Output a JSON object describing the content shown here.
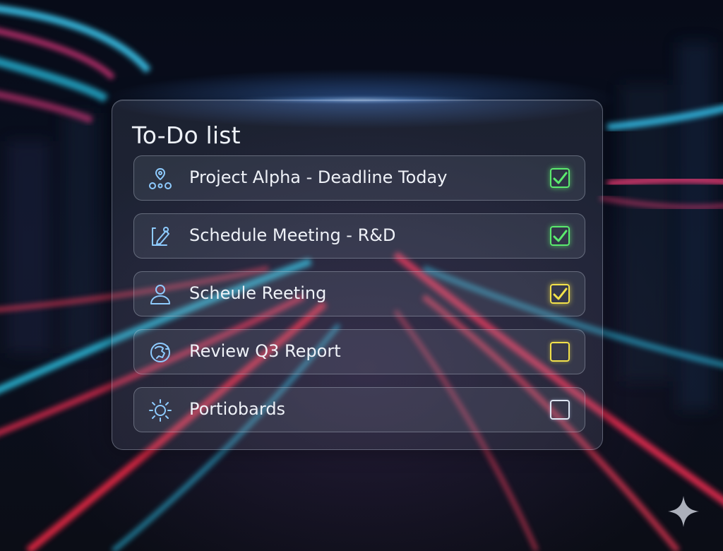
{
  "todo": {
    "title": "To-Do list",
    "tasks": [
      {
        "label": "Project Alpha - Deadline Today",
        "icon": "location-pin-nodes-icon",
        "state": "checked",
        "check_color": "#5bea6e"
      },
      {
        "label": "Schedule Meeting - R&D",
        "icon": "calendar-edit-icon",
        "state": "checked",
        "check_color": "#5bea6e"
      },
      {
        "label": "Scheule Reeting",
        "icon": "user-icon",
        "state": "checked",
        "check_color": "#f2e14a"
      },
      {
        "label": "Review Q3 Report",
        "icon": "refresh-globe-icon",
        "state": "unchecked",
        "check_color": "#f2e14a"
      },
      {
        "label": "Portiobards",
        "icon": "sun-icon",
        "state": "unchecked",
        "check_color": "#dfe6f2"
      }
    ]
  },
  "colors": {
    "accent_blue": "#4aa3ff",
    "icon_stroke": "#8ecbff",
    "check_green": "#5bea6e",
    "check_yellow": "#f2e14a"
  },
  "decor": {
    "corner_mark": "sparkle-icon"
  }
}
